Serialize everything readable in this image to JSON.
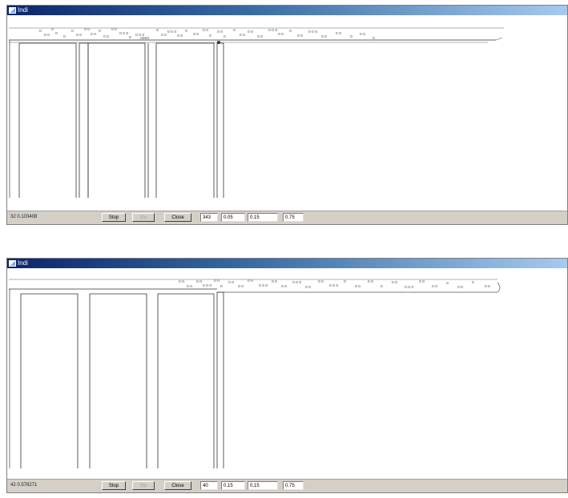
{
  "windows": [
    {
      "title": "Indi",
      "status_text": "32  0.103408",
      "buttons": {
        "stop": "Stop",
        "go": "Go",
        "close": "Close"
      },
      "fields": [
        "343",
        "0.05",
        "0.15",
        "0.75"
      ],
      "icons": [
        "app-icon"
      ]
    },
    {
      "title": "Indi",
      "status_text": "42  0.578271",
      "buttons": {
        "stop": "Stop",
        "go": "Go",
        "close": "Close"
      },
      "fields": [
        "40",
        "0.15",
        "0.15",
        "0.75"
      ],
      "icons": [
        "app-icon"
      ]
    }
  ],
  "colors": {
    "titlebar_start": "#0a246a",
    "titlebar_end": "#a6caf0",
    "statusbar": "#d4d0c8"
  }
}
